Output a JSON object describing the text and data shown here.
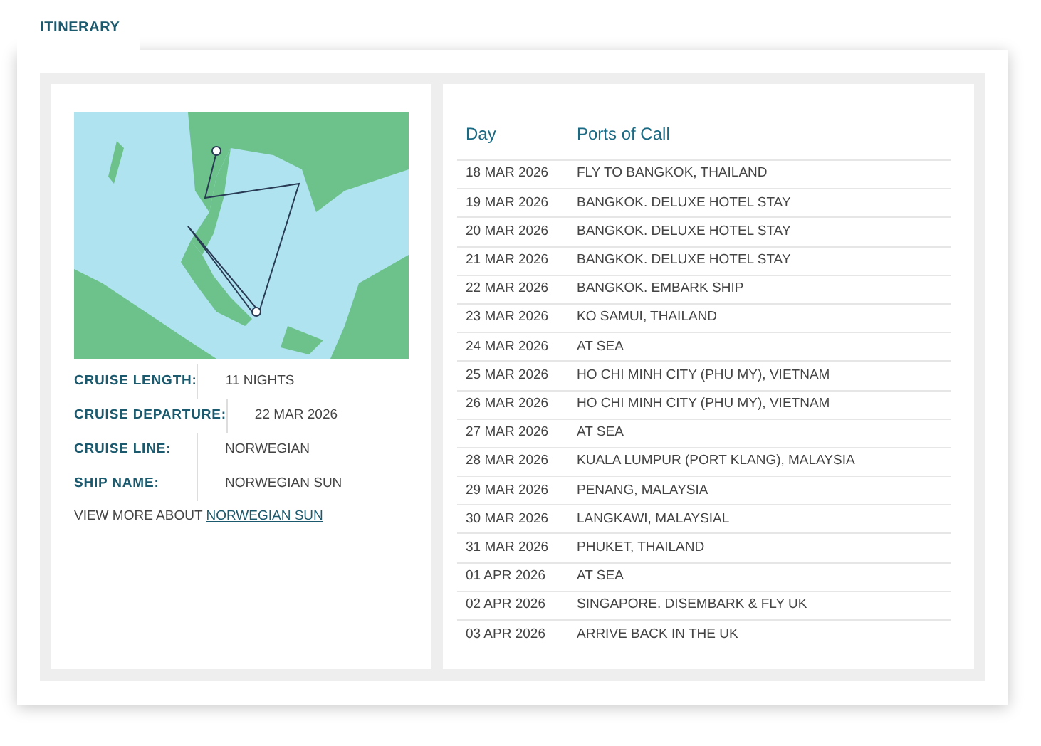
{
  "tab": {
    "label": "ITINERARY",
    "selected": true
  },
  "details": [
    {
      "label": "CRUISE LENGTH:",
      "value": "11 NIGHTS"
    },
    {
      "label": "CRUISE DEPARTURE:",
      "value": "22 MAR 2026"
    },
    {
      "label": "CRUISE LINE:",
      "value": "NORWEGIAN"
    },
    {
      "label": "SHIP NAME:",
      "value": "NORWEGIAN SUN"
    }
  ],
  "view_more": {
    "text": "VIEW MORE ABOUT",
    "link": "NORWEGIAN SUN"
  },
  "table": {
    "columns": [
      "Day",
      "Ports of Call"
    ],
    "rows": [
      [
        "18 MAR 2026",
        "FLY TO BANGKOK, THAILAND"
      ],
      [
        "19 MAR 2026",
        "BANGKOK. DELUXE HOTEL STAY"
      ],
      [
        "20 MAR 2026",
        "BANGKOK. DELUXE HOTEL STAY"
      ],
      [
        "21 MAR 2026",
        "BANGKOK. DELUXE HOTEL STAY"
      ],
      [
        "22 MAR 2026",
        "BANGKOK. EMBARK SHIP"
      ],
      [
        "23 MAR 2026",
        "KO SAMUI, THAILAND"
      ],
      [
        "24 MAR 2026",
        "AT SEA"
      ],
      [
        "25 MAR 2026",
        "HO CHI MINH CITY (PHU MY), VIETNAM"
      ],
      [
        "26 MAR 2026",
        "HO CHI MINH CITY (PHU MY), VIETNAM"
      ],
      [
        "27 MAR 2026",
        "AT SEA"
      ],
      [
        "28 MAR 2026",
        "KUALA LUMPUR (PORT KLANG), MALAYSIA"
      ],
      [
        "29 MAR 2026",
        "PENANG, MALAYSIA"
      ],
      [
        "30 MAR 2026",
        "LANGKAWI, MALAYSIAL"
      ],
      [
        "31 MAR 2026",
        "PHUKET, THAILAND"
      ],
      [
        "01 APR 2026",
        "AT SEA"
      ],
      [
        "02 APR 2026",
        "SINGAPORE. DISEMBARK & FLY UK"
      ],
      [
        "03 APR 2026",
        "ARRIVE BACK IN THE UK"
      ]
    ]
  }
}
